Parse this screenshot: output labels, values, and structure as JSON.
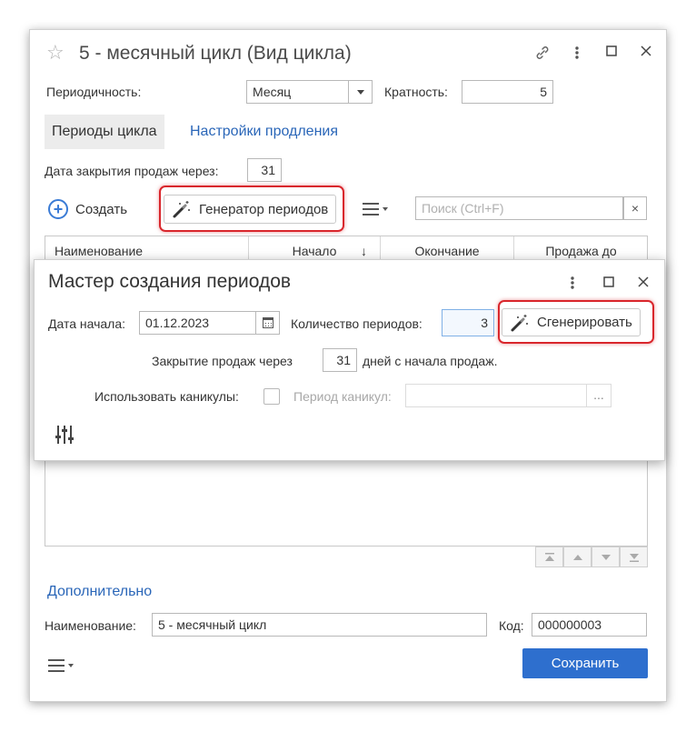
{
  "window": {
    "title": "5 - месячный цикл (Вид цикла)"
  },
  "form": {
    "periodicity_label": "Периодичность:",
    "periodicity_value": "Месяц",
    "multiplicity_label": "Кратность:",
    "multiplicity_value": "5"
  },
  "tabs": [
    {
      "label": "Периоды цикла"
    },
    {
      "label": "Настройки продления"
    }
  ],
  "sales_close": {
    "label": "Дата закрытия продаж через:",
    "value": "31"
  },
  "toolbar": {
    "create_label": "Создать",
    "generator_label": "Генератор периодов",
    "search_placeholder": "Поиск (Ctrl+F)",
    "clear_label": "×"
  },
  "table": {
    "columns": [
      "Наименование",
      "Начало",
      "Окончание",
      "Продажа до"
    ],
    "sort_indicator": "↓"
  },
  "dialog": {
    "title": "Мастер создания периодов",
    "start_date_label": "Дата начала:",
    "start_date_value": "01.12.2023",
    "count_label": "Количество периодов:",
    "count_value": "3",
    "generate_label": "Сгенерировать",
    "close_sales_label": "Закрытие продаж через",
    "close_sales_value": "31",
    "close_sales_suffix": "дней с начала продаж.",
    "use_holidays_label": "Использовать каникулы:",
    "holiday_period_label": "Период каникул:",
    "holiday_period_value": "",
    "ellipsis": "..."
  },
  "bottom": {
    "additional_label": "Дополнительно",
    "name_label": "Наименование:",
    "name_value": "5 - месячный цикл",
    "code_label": "Код:",
    "code_value": "000000003",
    "save_label": "Сохранить"
  },
  "colors": {
    "accent": "#2e6fce",
    "link": "#2a66b8",
    "highlight": "#d9262c"
  }
}
